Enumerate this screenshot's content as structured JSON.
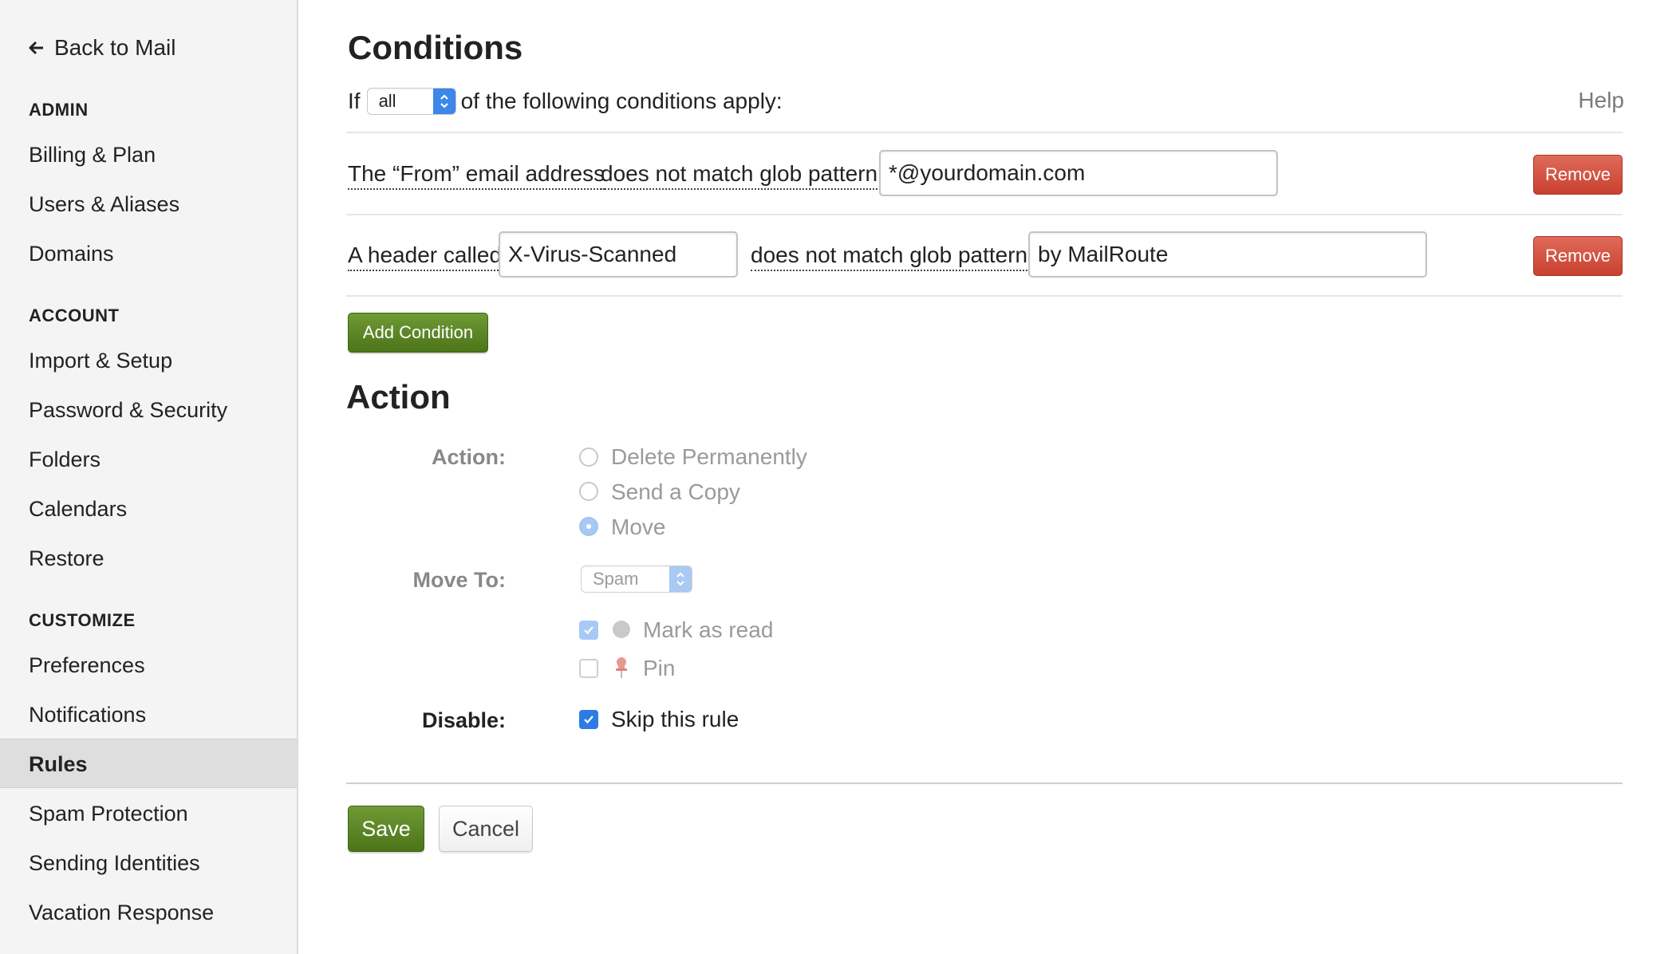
{
  "sidebar": {
    "back_label": "Back to Mail",
    "sections": [
      {
        "title": "ADMIN",
        "items": [
          "Billing & Plan",
          "Users & Aliases",
          "Domains"
        ]
      },
      {
        "title": "ACCOUNT",
        "items": [
          "Import & Setup",
          "Password & Security",
          "Folders",
          "Calendars",
          "Restore"
        ]
      },
      {
        "title": "CUSTOMIZE",
        "items": [
          "Preferences",
          "Notifications",
          "Rules",
          "Spam Protection",
          "Sending Identities",
          "Vacation Response"
        ]
      }
    ],
    "active_item": "Rules"
  },
  "conditions": {
    "heading": "Conditions",
    "if_prefix": "If",
    "match_select": "all",
    "if_suffix": "of the following conditions apply:",
    "help": "Help",
    "rows": [
      {
        "field": "The “From” email address",
        "operator": "does not match glob pattern",
        "value": "*@yourdomain.com",
        "remove": "Remove"
      },
      {
        "field": "A header called",
        "header_name": "X-Virus-Scanned",
        "operator": "does not match glob pattern",
        "value": "by MailRoute",
        "remove": "Remove"
      }
    ],
    "add_button": "Add Condition"
  },
  "action": {
    "heading": "Action",
    "action_label": "Action:",
    "options": [
      "Delete Permanently",
      "Send a Copy",
      "Move"
    ],
    "selected_option": "Move",
    "move_to_label": "Move To:",
    "move_to_value": "Spam",
    "mark_as_read": "Mark as read",
    "mark_as_read_checked": true,
    "pin": "Pin",
    "pin_checked": false,
    "disable_label": "Disable:",
    "skip_rule": "Skip this rule",
    "skip_rule_checked": true
  },
  "footer": {
    "save": "Save",
    "cancel": "Cancel"
  },
  "colors": {
    "accent_blue": "#3d86ea",
    "remove_red": "#c8412f",
    "button_green": "#4c7419",
    "sidebar_bg": "#f4f4f4",
    "active_item_bg": "#dedede"
  }
}
